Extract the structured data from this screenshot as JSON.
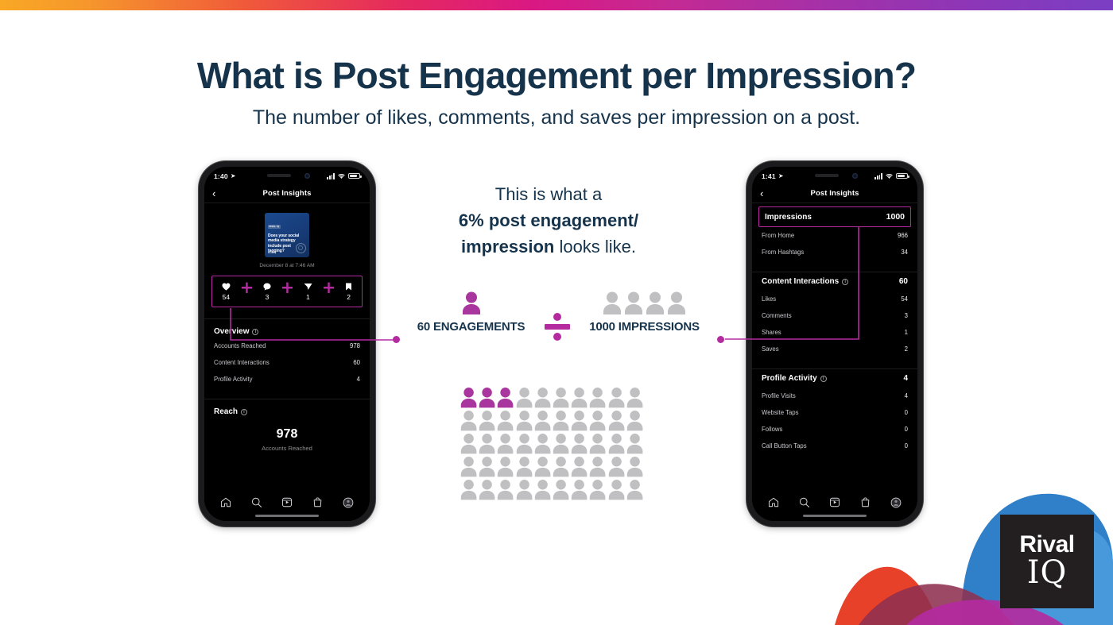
{
  "header": {
    "title": "What is Post Engagement per Impression?",
    "subtitle": "The number of likes, comments, and saves per impression on a post.",
    "title_color": "#16334C"
  },
  "accent": {
    "magenta": "#B42BA0",
    "person_purple": "#A8369E",
    "person_grey": "#C0C0C2",
    "navy": "#16334C"
  },
  "phone_left": {
    "status": {
      "time": "1:40",
      "location_icon": "location-arrow-icon"
    },
    "nav": {
      "back_icon": "chevron-left-icon",
      "title": "Post Insights"
    },
    "post": {
      "tag": "RIVAL IQ",
      "headline": "Does your social media strategy include post tagging?",
      "logo": "RivalIQ",
      "date": "December 8 at 7:46 AM"
    },
    "engagement_row": {
      "items": [
        {
          "icon": "heart-icon",
          "value": "54"
        },
        {
          "icon": "comment-icon",
          "value": "3"
        },
        {
          "icon": "share-icon",
          "value": "1"
        },
        {
          "icon": "bookmark-icon",
          "value": "2"
        }
      ],
      "operator": "+"
    },
    "overview": {
      "title": "Overview",
      "rows": [
        {
          "label": "Accounts Reached",
          "value": "978"
        },
        {
          "label": "Content Interactions",
          "value": "60"
        },
        {
          "label": "Profile Activity",
          "value": "4"
        }
      ]
    },
    "reach": {
      "title": "Reach",
      "big_value": "978",
      "caption": "Accounts Reached"
    },
    "tabbar": [
      "home-icon",
      "search-icon",
      "reels-icon",
      "shop-icon",
      "profile-avatar-icon"
    ]
  },
  "phone_right": {
    "status": {
      "time": "1:41",
      "location_icon": "location-arrow-icon"
    },
    "nav": {
      "back_icon": "chevron-left-icon",
      "title": "Post Insights"
    },
    "impressions": {
      "label": "Impressions",
      "value": "1000"
    },
    "impression_sources": [
      {
        "label": "From Home",
        "value": "966"
      },
      {
        "label": "From Hashtags",
        "value": "34"
      }
    ],
    "content_interactions": {
      "title": "Content Interactions",
      "total": "60",
      "rows": [
        {
          "label": "Likes",
          "value": "54"
        },
        {
          "label": "Comments",
          "value": "3"
        },
        {
          "label": "Shares",
          "value": "1"
        },
        {
          "label": "Saves",
          "value": "2"
        }
      ]
    },
    "profile_activity": {
      "title": "Profile Activity",
      "total": "4",
      "rows": [
        {
          "label": "Profile Visits",
          "value": "4"
        },
        {
          "label": "Website Taps",
          "value": "0"
        },
        {
          "label": "Follows",
          "value": "0"
        },
        {
          "label": "Call Button Taps",
          "value": "0"
        }
      ]
    },
    "tabbar": [
      "home-icon",
      "search-icon",
      "reels-icon",
      "shop-icon",
      "profile-avatar-icon"
    ]
  },
  "center": {
    "line1": "This is what a",
    "line2_bold": "6% post engagement/",
    "line3_bold": "impression",
    "line3_rest": " looks like."
  },
  "equation": {
    "numerator_label": "60 ENGAGEMENTS",
    "numerator_icons": 1,
    "operator": "divide-icon",
    "denominator_label": "1000 IMPRESSIONS",
    "denominator_icons": 4
  },
  "chart_data": {
    "type": "pictogram",
    "title": "6% post engagement per impression",
    "total_icons": 50,
    "highlighted_icons": 3,
    "columns": 10,
    "rows": 5,
    "percent": 6,
    "engagements": 60,
    "impressions": 1000,
    "highlight_color": "#A8369E",
    "base_color": "#C0C0C2"
  },
  "logo": {
    "line1": "Rival",
    "line2": "IQ"
  }
}
